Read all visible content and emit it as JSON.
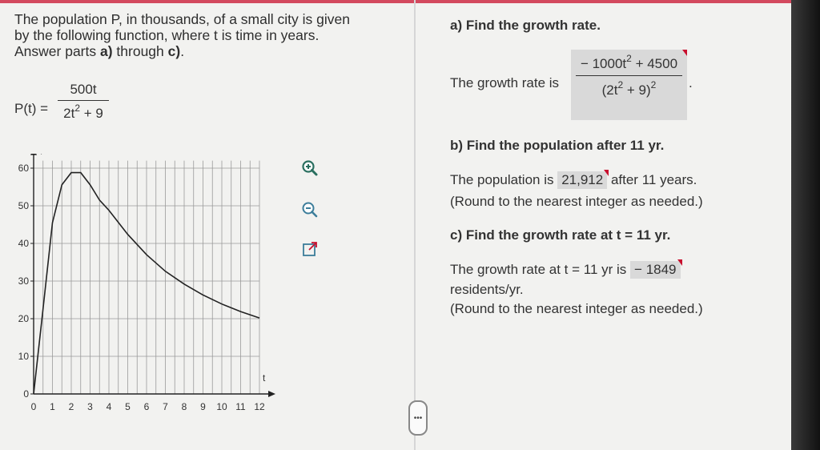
{
  "problem": {
    "line1": "The population P, in thousands, of a small city is given",
    "line2": "by the following function, where t is time in years.",
    "line3_prefix": "Answer parts ",
    "line3_a": "a)",
    "line3_mid": " through ",
    "line3_c": "c)",
    "line3_end": ".",
    "function_lhs": "P(t) =",
    "function_num": "500t",
    "function_den_base": "2t",
    "function_den_exp": "2",
    "function_den_tail": " + 9"
  },
  "graph": {
    "y_axis_label": "P",
    "x_axis_label": "t",
    "y_ticks": [
      "60",
      "50",
      "40",
      "30",
      "20",
      "10",
      "0"
    ],
    "x_ticks": [
      "0",
      "1",
      "2",
      "3",
      "4",
      "5",
      "6",
      "7",
      "8",
      "9",
      "10",
      "11",
      "12"
    ]
  },
  "chart_data": {
    "type": "line",
    "x": [
      0,
      0.5,
      1,
      1.5,
      2,
      2.5,
      3,
      3.5,
      4,
      5,
      6,
      7,
      8,
      9,
      10,
      11,
      12
    ],
    "y": [
      0,
      22.7,
      45.5,
      55.6,
      58.8,
      58.8,
      55.6,
      51.5,
      48.8,
      42.4,
      37.0,
      32.6,
      29.2,
      26.3,
      23.9,
      21.9,
      20.2
    ],
    "xlabel": "t",
    "ylabel": "P",
    "xlim": [
      0,
      12
    ],
    "ylim": [
      0,
      60
    ],
    "grid": true
  },
  "icons": {
    "zoom_in": "zoom-in-icon",
    "zoom_out": "zoom-out-icon",
    "popout": "popout-icon"
  },
  "handle_text": "•••",
  "part_a": {
    "heading": "a) Find the growth rate.",
    "label": "The growth rate is",
    "num_a": "− 1000t",
    "num_exp": "2",
    "num_b": " + 4500",
    "den_a": "(2t",
    "den_inner_exp": "2",
    "den_b": " + 9)",
    "den_exp": "2",
    "end": "."
  },
  "part_b": {
    "heading": "b) Find the population after 11 yr.",
    "label": "The population is",
    "answer": "21,912",
    "after": "after 11 years.",
    "note": "(Round to the nearest integer as needed.)"
  },
  "part_c": {
    "heading": "c) Find the growth rate at t = 11 yr.",
    "label": "The growth rate at t = 11 yr is",
    "answer": "− 1849",
    "units": "residents/yr.",
    "note": "(Round to the nearest integer as needed.)"
  },
  "colors": {
    "accent_red": "#c8102e",
    "answer_bg": "#d9d9d9"
  }
}
